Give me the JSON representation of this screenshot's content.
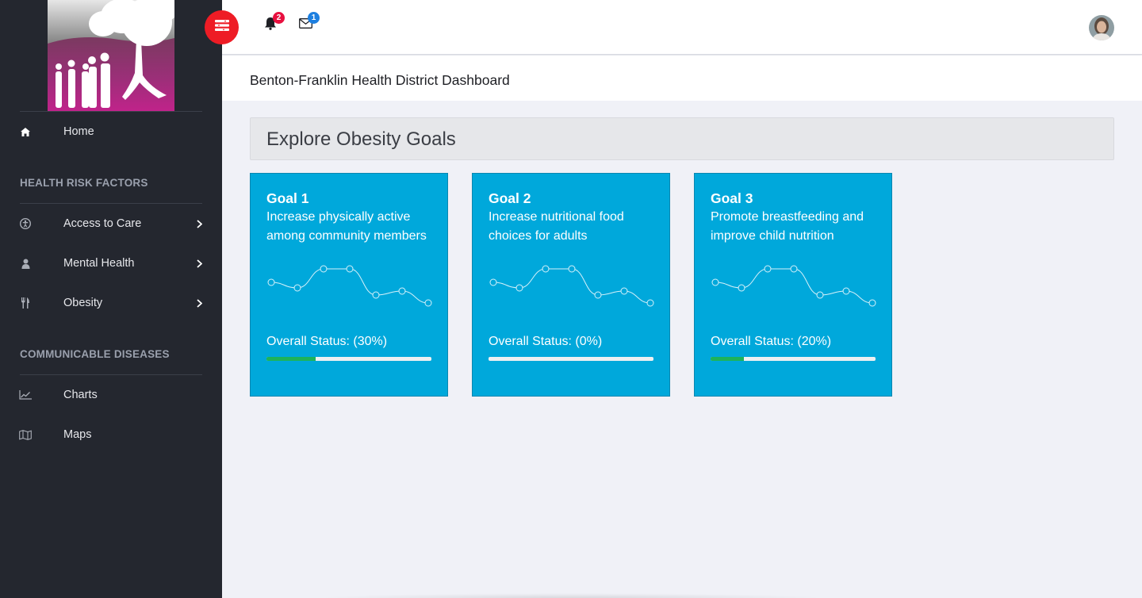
{
  "sidebar": {
    "home": {
      "label": "Home",
      "icon": "home-icon"
    },
    "section1": "HEALTH RISK FACTORS",
    "risk_items": [
      {
        "label": "Access to Care",
        "icon": "universal-access-icon"
      },
      {
        "label": "Mental Health",
        "icon": "user-icon"
      },
      {
        "label": "Obesity",
        "icon": "cutlery-icon"
      }
    ],
    "section2": "COMMUNICABLE DISEASES",
    "disease_items": [
      {
        "label": "Charts",
        "icon": "line-chart-icon"
      },
      {
        "label": "Maps",
        "icon": "map-icon"
      }
    ]
  },
  "topbar": {
    "notifications_count": "2",
    "messages_count": "1"
  },
  "page": {
    "title": "Benton-Franklin Health District Dashboard",
    "section_title": "Explore Obesity Goals"
  },
  "goals": [
    {
      "title": "Goal 1",
      "description": "Increase physically active among community members",
      "status": "Overall Status: (30%)",
      "progress": 0.3
    },
    {
      "title": "Goal 2",
      "description": "Increase nutritional food choices for adults",
      "status": "Overall Status: (0%)",
      "progress": 0.0
    },
    {
      "title": "Goal 3",
      "description": "Promote breastfeeding and improve child nutrition",
      "status": "Overall Status: (20%)",
      "progress": 0.2
    }
  ],
  "colors": {
    "sidebar_bg": "#24272f",
    "card_bg": "#00a8db",
    "progress_fill": "#1db35a",
    "toggle_red": "#ee1c25"
  }
}
